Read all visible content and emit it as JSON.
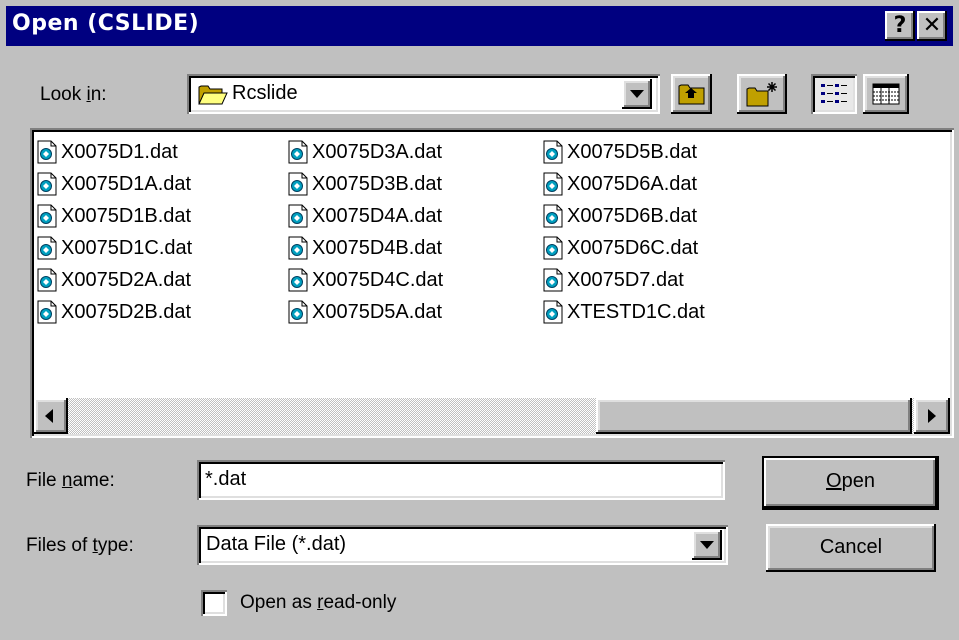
{
  "window": {
    "title": "Open (CSLIDE)",
    "help_label": "?",
    "close_label": "✕"
  },
  "lookin": {
    "label_pre": "Look ",
    "label_u": "i",
    "label_post": "n:",
    "value": "Rcslide",
    "folder_icon": "folder-open-icon"
  },
  "toolbar": {
    "up_icon": "up-one-level-icon",
    "new_folder_icon": "new-folder-icon",
    "list_view_icon": "list-view-icon",
    "details_view_icon": "details-view-icon"
  },
  "files": {
    "columns": [
      [
        "X0075D1.dat",
        "X0075D1A.dat",
        "X0075D1B.dat",
        "X0075D1C.dat",
        "X0075D2A.dat",
        "X0075D2B.dat"
      ],
      [
        "X0075D3A.dat",
        "X0075D3B.dat",
        "X0075D4A.dat",
        "X0075D4B.dat",
        "X0075D4C.dat",
        "X0075D5A.dat"
      ],
      [
        "X0075D5B.dat",
        "X0075D6A.dat",
        "X0075D6B.dat",
        "X0075D6C.dat",
        "X0075D7.dat",
        "XTESTD1C.dat"
      ]
    ]
  },
  "filename": {
    "label_pre": "File ",
    "label_u": "n",
    "label_post": "ame:",
    "value": "*.dat"
  },
  "filetype": {
    "label_pre": "Files of ",
    "label_u": "t",
    "label_post": "ype:",
    "value": "Data File (*.dat)"
  },
  "buttons": {
    "open_u": "O",
    "open_rest": "pen",
    "cancel": "Cancel"
  },
  "readonly": {
    "label_pre": "Open as ",
    "label_u": "r",
    "label_post": "ead-only",
    "checked": false
  }
}
